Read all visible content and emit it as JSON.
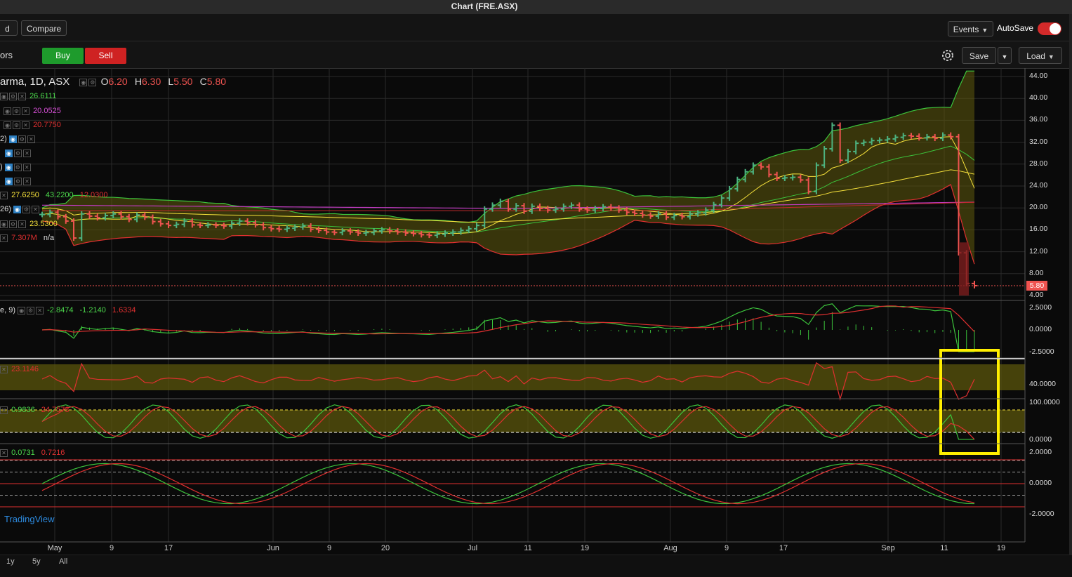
{
  "window": {
    "title": "Chart (FRE.ASX)"
  },
  "toolbar": {
    "partial_button": "d",
    "compare": "Compare",
    "events": "Events",
    "autosave": "AutoSave",
    "partial_studies": "ors",
    "buy": "Buy",
    "sell": "Sell",
    "save": "Save",
    "load": "Load",
    "autosave_on": true
  },
  "colors": {
    "up": "#4db380",
    "down": "#ef5350",
    "accent": "#1e9b2c",
    "highlight": "#ffee00"
  },
  "legend": {
    "symbol": "arma, 1D, ASX",
    "open_label": "O",
    "open": "6.20",
    "high_label": "H",
    "high": "6.30",
    "low_label": "L",
    "low": "5.50",
    "close_label": "C",
    "close": "5.80",
    "bb_upper": "26.6111",
    "ma_magenta": "20.0525",
    "ma_red": "20.7750",
    "label_2": "2)",
    "label_paren": ")",
    "ichimoku_a": "27.6250",
    "ichimoku_b": "43.2200",
    "ichimoku_c": "12.0300",
    "label_26": "26)",
    "ma_yellow": "23.5300",
    "volume": "7.307M",
    "volume_ma": "n/a"
  },
  "macd_legend": {
    "label": "e, 9)",
    "macd": "-2.8474",
    "signal": "-1.2140",
    "hist": "1.6334"
  },
  "rsi_legend": {
    "value": "23.1146"
  },
  "stoch_legend": {
    "k": "0.9836",
    "d": "24.7573"
  },
  "osc_legend": {
    "a": "0.0731",
    "b": "0.7216"
  },
  "price_axis": [
    "44.00",
    "40.00",
    "36.00",
    "32.00",
    "28.00",
    "24.00",
    "20.00",
    "16.00",
    "12.00",
    "8.00",
    "4.00"
  ],
  "current_price": "5.80",
  "macd_axis": [
    "2.5000",
    "0.0000",
    "-2.5000"
  ],
  "rsi_axis": [
    "40.0000"
  ],
  "stoch_axis": [
    "100.0000",
    "0.0000"
  ],
  "osc_axis": [
    "2.0000",
    "0.0000",
    "-2.0000"
  ],
  "time_axis": [
    "May",
    "9",
    "17",
    "Jun",
    "9",
    "20",
    "Jul",
    "11",
    "19",
    "Aug",
    "9",
    "17",
    "Sep",
    "11",
    "19"
  ],
  "branding": "TradingView",
  "ranges": [
    "1y",
    "5y",
    "All"
  ],
  "chart_data": {
    "type": "candlestick",
    "title": "",
    "symbol_partial": "arma, 1D, ASX",
    "ylim": [
      4,
      44
    ],
    "last_bar": {
      "open": 6.2,
      "high": 6.3,
      "low": 5.5,
      "close": 5.8
    },
    "closes": [
      18.8,
      19.2,
      18.4,
      17.6,
      14.5,
      18.9,
      18.5,
      18.2,
      18.6,
      18.9,
      18.4,
      17.9,
      18.7,
      18.3,
      17.5,
      17.1,
      16.8,
      17.0,
      17.6,
      16.9,
      16.8,
      16.9,
      16.8,
      16.7,
      17.2,
      17.6,
      17.3,
      16.9,
      16.4,
      16.2,
      16.1,
      16.3,
      16.5,
      16.7,
      16.1,
      15.9,
      15.6,
      15.5,
      15.8,
      15.6,
      15.4,
      15.5,
      15.8,
      16.0,
      15.8,
      15.6,
      15.4,
      15.3,
      15.1,
      15.0,
      15.2,
      15.4,
      15.6,
      15.9,
      16.2,
      16.8,
      19.8,
      20.5,
      21.2,
      19.8,
      20.4,
      19.4,
      20.3,
      19.9,
      19.6,
      19.8,
      20.3,
      20.5,
      19.8,
      19.6,
      19.9,
      20.2,
      20.0,
      19.6,
      19.2,
      19.0,
      18.7,
      18.5,
      18.9,
      18.3,
      18.6,
      18.4,
      18.9,
      19.1,
      19.6,
      20.6,
      21.8,
      23.5,
      25.2,
      26.6,
      27.8,
      27.5,
      26.1,
      25.4,
      25.5,
      25.6,
      25.1,
      23.0,
      27.8,
      30.8,
      35.1,
      28.7,
      30.3,
      31.8,
      32.0,
      32.3,
      32.4,
      32.6,
      32.9,
      33.2,
      33.1,
      32.8,
      33.0,
      32.7,
      33.3,
      33.0,
      11.8,
      6.2,
      5.8
    ],
    "indicators": {
      "bollinger_upper": 26.6111,
      "ma_magenta": 20.0525,
      "ma_red": 20.775,
      "ma_yellow": 23.53,
      "volume": "7.307M"
    },
    "macd": {
      "macd": -2.8474,
      "signal": -1.214,
      "histogram": 1.6334,
      "ylim": [
        -2.5,
        2.5
      ]
    },
    "rsi": {
      "value": 23.1146
    },
    "stochastic": {
      "k": 0.9836,
      "d": 24.7573,
      "ylim": [
        0,
        100
      ]
    },
    "oscillator": {
      "a": 0.0731,
      "b": 0.7216,
      "ylim": [
        -2,
        2
      ]
    },
    "x_ticks": [
      "May",
      "9",
      "17",
      "Jun",
      "9",
      "20",
      "Jul",
      "11",
      "19",
      "Aug",
      "9",
      "17",
      "Sep",
      "11",
      "19"
    ]
  }
}
